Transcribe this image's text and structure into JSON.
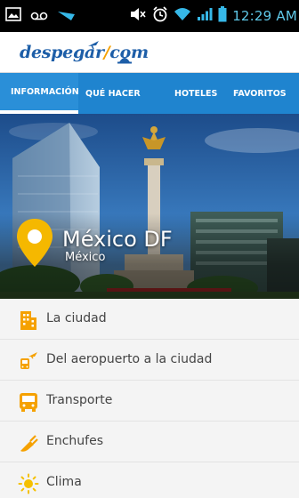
{
  "status_bar": {
    "time": "12:29 AM",
    "icons": [
      "gallery-icon",
      "voicemail-icon",
      "signal-arrow-icon",
      "mute-volume-icon",
      "alarm-icon",
      "wifi-icon",
      "cell-signal-icon",
      "battery-icon"
    ]
  },
  "header": {
    "logo_text_main": "despegar",
    "logo_text_com": "com",
    "brand_colors": {
      "blue": "#1d5ea8",
      "orange": "#f5a100"
    }
  },
  "tabs": [
    {
      "label": "INFORMACIÓN",
      "active": true
    },
    {
      "label": "QUÉ HACER",
      "active": false
    },
    {
      "label": "HOTELES",
      "active": false
    },
    {
      "label": "FAVORITOS",
      "active": false
    }
  ],
  "hero": {
    "city": "México DF",
    "country": "México",
    "pin_color": "#f5b800"
  },
  "list": [
    {
      "label": "La ciudad",
      "icon": "city-building-icon"
    },
    {
      "label": "Del aeropuerto a la ciudad",
      "icon": "airport-to-city-icon"
    },
    {
      "label": "Transporte",
      "icon": "bus-icon"
    },
    {
      "label": "Enchufes",
      "icon": "plug-icon"
    },
    {
      "label": "Clima",
      "icon": "sun-icon"
    }
  ],
  "accent_color": "#1f84cf",
  "icon_color": "#f5a100"
}
